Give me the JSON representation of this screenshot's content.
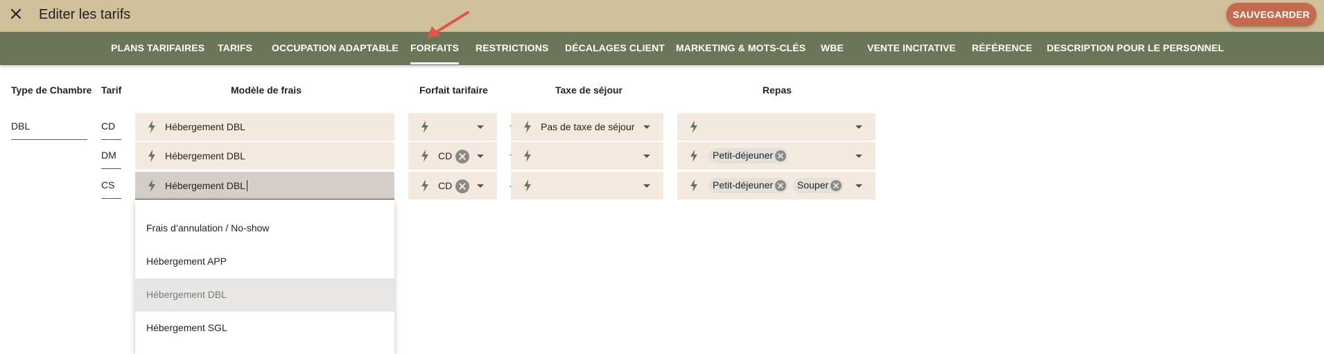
{
  "header": {
    "title": "Editer les tarifs",
    "close_icon": "close-icon",
    "save_label": "SAUVEGARDER",
    "colors": {
      "topbar": "#d0c09c",
      "navbar": "#6b7558",
      "save": "#c46a4f",
      "field": "#f3e9de",
      "annotation_arrow": "#e05545"
    }
  },
  "nav": {
    "active": "FORFAITS",
    "tabs": [
      "PLANS TARIFAIRES",
      "TARIFS",
      "OCCUPATION ADAPTABLE",
      "FORFAITS",
      "RESTRICTIONS",
      "DÉCALAGES CLIENT",
      "MARKETING & MOTS-CLÉS",
      "WBE",
      "VENTE INCITATIVE",
      "RÉFÉRENCE",
      "DESCRIPTION POUR LE PERSONNEL"
    ]
  },
  "table": {
    "headers": {
      "room_type": "Type de Chambre",
      "rate": "Tarif",
      "fee_model": "Modèle de frais",
      "rate_package": "Forfait tarifaire",
      "tourist_tax": "Taxe de séjour",
      "meals": "Repas"
    },
    "room_type_value": "DBL",
    "rows": [
      {
        "rate": "CD",
        "fee_model": "Hébergement DBL",
        "rate_package": "",
        "tourist_tax": "Pas de taxe de séjour",
        "meals": []
      },
      {
        "rate": "DM",
        "fee_model": "Hébergement DBL",
        "rate_package": "CD",
        "tourist_tax": "",
        "meals": [
          "Petit-déjeuner"
        ]
      },
      {
        "rate": "CS",
        "fee_model": "Hébergement DBL",
        "rate_package": "CD",
        "tourist_tax": "",
        "meals": [
          "Petit-déjeuner",
          "Souper"
        ]
      }
    ]
  },
  "dropdown_menu": {
    "selected": "Hébergement DBL",
    "options": [
      "Frais d’annulation / No-show",
      "Hébergement APP",
      "Hébergement DBL",
      "Hébergement SGL"
    ]
  }
}
